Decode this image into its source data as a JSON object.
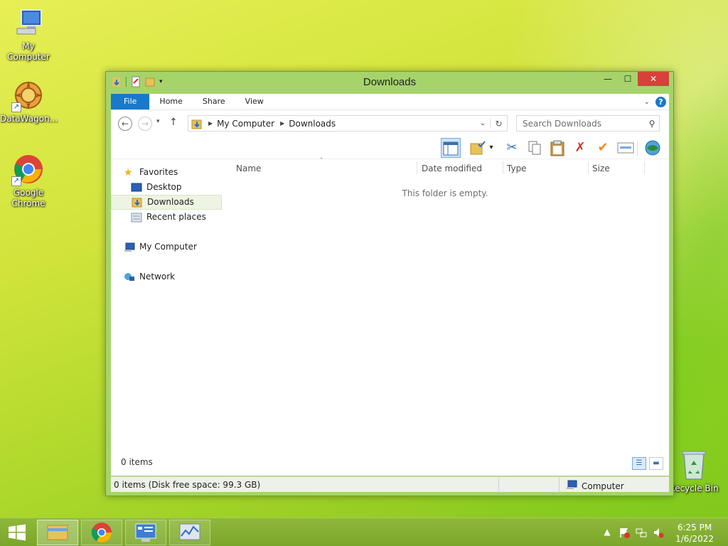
{
  "desktop": {
    "icons": [
      {
        "label": "My Computer"
      },
      {
        "label": "DataWagon..."
      },
      {
        "label": "Google\nChrome"
      },
      {
        "label": "Recycle Bin"
      }
    ]
  },
  "window": {
    "title": "Downloads",
    "ribbon": {
      "tabs": [
        "File",
        "Home",
        "Share",
        "View"
      ]
    },
    "address": {
      "crumbs": [
        "My Computer",
        "Downloads"
      ]
    },
    "search": {
      "placeholder": "Search Downloads"
    },
    "nav_pane": {
      "favorites": "Favorites",
      "desktop": "Desktop",
      "downloads": "Downloads",
      "recent": "Recent places",
      "my_computer": "My Computer",
      "network": "Network"
    },
    "columns": [
      "Name",
      "Date modified",
      "Type",
      "Size"
    ],
    "empty_message": "This folder is empty.",
    "items_count": "0 items",
    "status": {
      "left": "0 items (Disk free space: 99.3 GB)",
      "right": "Computer"
    }
  },
  "taskbar": {
    "time": "6:25 PM",
    "date": "1/6/2022"
  },
  "colors": {
    "accent": "#1979ca",
    "window_frame": "#a6d46a",
    "close": "#d9403a"
  }
}
